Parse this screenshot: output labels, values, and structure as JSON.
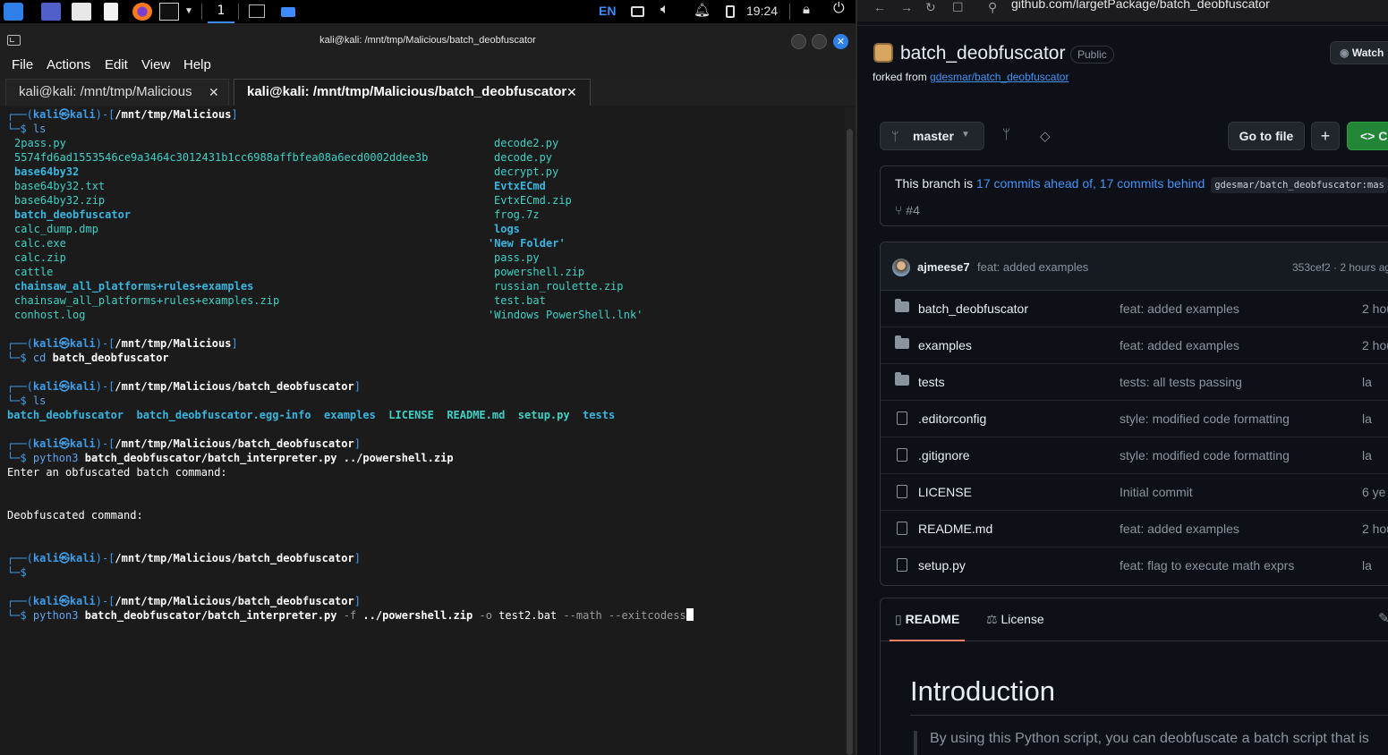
{
  "panel": {
    "workspace": "1",
    "language": "EN",
    "clock": "19:24"
  },
  "terminal": {
    "title": "kali@kali: /mnt/tmp/Malicious/batch_deobfuscator",
    "menu": [
      "File",
      "Actions",
      "Edit",
      "View",
      "Help"
    ],
    "tabs": [
      {
        "label": "kali@kali: /mnt/tmp/Malicious"
      },
      {
        "label": "kali@kali: /mnt/tmp/Malicious/batch_deobfuscator"
      }
    ],
    "user": "kali",
    "host": "kali",
    "dir1": "/mnt/tmp/Malicious",
    "dir2": "/mnt/tmp/Malicious/batch_deobfuscator",
    "cmd_ls": "ls",
    "cmd_cd": "cd",
    "cmd_cd_arg": "batch_deobfuscator",
    "ls1_left": [
      "2pass.py",
      "5574fd6ad1553546ce9a3464c3012431b1cc6988affbfea08a6ecd0002ddee3b",
      "base64by32",
      "base64by32.txt",
      "base64by32.zip",
      "batch_deobfuscator",
      "calc_dump.dmp",
      "calc.exe",
      "calc.zip",
      "cattle",
      "chainsaw_all_platforms+rules+examples",
      "chainsaw_all_platforms+rules+examples.zip",
      "conhost.log"
    ],
    "ls1_right": [
      "decode2.py",
      "decode.py",
      "decrypt.py",
      "EvtxECmd",
      "EvtxECmd.zip",
      "frog.7z",
      "logs",
      "'New Folder'",
      "pass.py",
      "powershell.zip",
      "russian_roulette.zip",
      "test.bat",
      "'Windows PowerShell.lnk'"
    ],
    "ls2": [
      "batch_deobfuscator",
      "batch_deobfuscator.egg-info",
      "examples",
      "LICENSE",
      "README.md",
      "setup.py",
      "tests"
    ],
    "python": "python3",
    "script": "batch_deobfuscator/batch_interpreter.py",
    "zip_arg": "../powershell.zip",
    "out_enter": "Enter an obfuscated batch command:",
    "out_deob": "Deobfuscated command:",
    "flag_f": "-f",
    "flag_o": "-o",
    "out_file": "test2.bat",
    "flag_math": "--math",
    "flag_exit": "--exitcodess"
  },
  "browser": {
    "url": "github.com/largetPackage/batch_deobfuscator",
    "repo_name": "batch_deobfuscator",
    "visibility": "Public",
    "forked_prefix": "forked from ",
    "forked_link": "gdesmar/batch_deobfuscator",
    "watch": "Watch",
    "branch": "master",
    "goto_file": "Go to file",
    "code_btn": "C",
    "branch_status": {
      "prefix": "This branch is ",
      "ahead": "17 commits ahead of,",
      "behind": "17 commits behind",
      "upstream": "gdesmar/batch_deobfuscator:mas",
      "pr": "#4"
    },
    "latest_commit": {
      "author": "ajmeese7",
      "message": "feat: added examples",
      "meta": "353cef2 · 2 hours ag"
    },
    "files": [
      {
        "name": "batch_deobfuscator",
        "type": "dir",
        "message": "feat: added examples",
        "age": "2 hou"
      },
      {
        "name": "examples",
        "type": "dir",
        "message": "feat: added examples",
        "age": "2 hou"
      },
      {
        "name": "tests",
        "type": "dir",
        "message": "tests: all tests passing",
        "age": "la"
      },
      {
        "name": ".editorconfig",
        "type": "file",
        "message": "style: modified code formatting",
        "age": "la"
      },
      {
        "name": ".gitignore",
        "type": "file",
        "message": "style: modified code formatting",
        "age": "la"
      },
      {
        "name": "LICENSE",
        "type": "file",
        "message": "Initial commit",
        "age": "6 ye"
      },
      {
        "name": "README.md",
        "type": "file",
        "message": "feat: added examples",
        "age": "2 hou"
      },
      {
        "name": "setup.py",
        "type": "file",
        "message": "feat: flag to execute math exprs",
        "age": "la"
      }
    ],
    "readme_tab": "README",
    "license_tab": "License",
    "readme_heading": "Introduction",
    "readme_text": "By using this Python script, you can deobfuscate a batch script that is"
  }
}
